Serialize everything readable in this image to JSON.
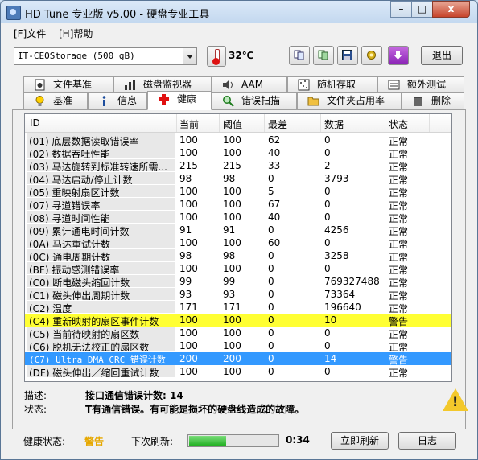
{
  "window": {
    "title": "HD Tune 专业版 v5.00 - 硬盘专业工具",
    "controls": {
      "minimize": "–",
      "maximize": "□",
      "close": "x"
    }
  },
  "menu": {
    "file": "[F]文件",
    "help": "[H]帮助"
  },
  "toolbar": {
    "drive": "IT-CEOStorage (500 gB)",
    "temperature": "32℃",
    "exit_label": "退出",
    "icons": [
      "copy-icon",
      "copy-all-icon",
      "save-icon",
      "options-icon",
      "download-icon"
    ]
  },
  "tabs": {
    "row1": [
      {
        "label": "文件基准",
        "icon": "file-benchmark-icon"
      },
      {
        "label": "磁盘监视器",
        "icon": "disk-monitor-icon"
      },
      {
        "label": "AAM",
        "icon": "speaker-icon"
      },
      {
        "label": "随机存取",
        "icon": "random-access-icon"
      },
      {
        "label": "额外测试",
        "icon": "extra-tests-icon"
      }
    ],
    "row2": [
      {
        "label": "基准",
        "icon": "lightbulb-icon"
      },
      {
        "label": "信息",
        "icon": "info-icon"
      },
      {
        "label": "健康",
        "icon": "health-cross-icon",
        "active": true
      },
      {
        "label": "错误扫描",
        "icon": "magnifier-icon"
      },
      {
        "label": "文件夹占用率",
        "icon": "folder-icon"
      },
      {
        "label": "删除",
        "icon": "trash-icon"
      }
    ]
  },
  "table": {
    "columns": [
      "ID",
      "当前",
      "阈值",
      "最差",
      "数据",
      "状态"
    ],
    "rows": [
      {
        "id": "(01) 底层数据读取错误率",
        "current": "100",
        "threshold": "100",
        "worst": "62",
        "data": "0",
        "status": "正常"
      },
      {
        "id": "(02) 数据吞吐性能",
        "current": "100",
        "threshold": "100",
        "worst": "40",
        "data": "0",
        "status": "正常"
      },
      {
        "id": "(03) 马达旋转到标准转速所需...",
        "current": "215",
        "threshold": "215",
        "worst": "33",
        "data": "2",
        "status": "正常"
      },
      {
        "id": "(04) 马达启动/停止计数",
        "current": "98",
        "threshold": "98",
        "worst": "0",
        "data": "3793",
        "status": "正常"
      },
      {
        "id": "(05) 重映射扇区计数",
        "current": "100",
        "threshold": "100",
        "worst": "5",
        "data": "0",
        "status": "正常"
      },
      {
        "id": "(07) 寻道错误率",
        "current": "100",
        "threshold": "100",
        "worst": "67",
        "data": "0",
        "status": "正常"
      },
      {
        "id": "(08) 寻道时间性能",
        "current": "100",
        "threshold": "100",
        "worst": "40",
        "data": "0",
        "status": "正常"
      },
      {
        "id": "(09) 累计通电时间计数",
        "current": "91",
        "threshold": "91",
        "worst": "0",
        "data": "4256",
        "status": "正常"
      },
      {
        "id": "(0A) 马达重试计数",
        "current": "100",
        "threshold": "100",
        "worst": "60",
        "data": "0",
        "status": "正常"
      },
      {
        "id": "(0C) 通电周期计数",
        "current": "98",
        "threshold": "98",
        "worst": "0",
        "data": "3258",
        "status": "正常"
      },
      {
        "id": "(BF) 振动感测错误率",
        "current": "100",
        "threshold": "100",
        "worst": "0",
        "data": "0",
        "status": "正常"
      },
      {
        "id": "(C0) 断电磁头缩回计数",
        "current": "99",
        "threshold": "99",
        "worst": "0",
        "data": "769327488",
        "status": "正常"
      },
      {
        "id": "(C1) 磁头伸出周期计数",
        "current": "93",
        "threshold": "93",
        "worst": "0",
        "data": "73364",
        "status": "正常"
      },
      {
        "id": "(C2) 温度",
        "current": "171",
        "threshold": "171",
        "worst": "0",
        "data": "196640",
        "status": "正常"
      },
      {
        "id": "(C4) 重新映射的扇区事件计数",
        "current": "100",
        "threshold": "100",
        "worst": "0",
        "data": "10",
        "status": "警告",
        "state": "warn"
      },
      {
        "id": "(C5) 当前待映射的扇区数",
        "current": "100",
        "threshold": "100",
        "worst": "0",
        "data": "0",
        "status": "正常"
      },
      {
        "id": "(C6) 脱机无法校正的扇区数",
        "current": "100",
        "threshold": "100",
        "worst": "0",
        "data": "0",
        "status": "正常"
      },
      {
        "id": "(C7) Ultra DMA CRC 错误计数",
        "current": "200",
        "threshold": "200",
        "worst": "0",
        "data": "14",
        "status": "警告",
        "state": "sel"
      },
      {
        "id": "(DF) 磁头伸出／缩回重试计数",
        "current": "100",
        "threshold": "100",
        "worst": "0",
        "data": "0",
        "status": "正常"
      }
    ]
  },
  "details": {
    "desc_label": "描述:",
    "desc_value": "接口通信错误计数: 14",
    "status_label": "状态:",
    "status_value": "T有通信错误。有可能是损坏的硬盘线造成的故障。"
  },
  "status": {
    "health_label": "健康状态:",
    "health_value": "警告",
    "health_color": "#e6a800",
    "refresh_label": "下次刷新:",
    "progress": 0.42,
    "countdown": "0:34",
    "refresh_button": "立即刷新",
    "log_button": "日志"
  }
}
